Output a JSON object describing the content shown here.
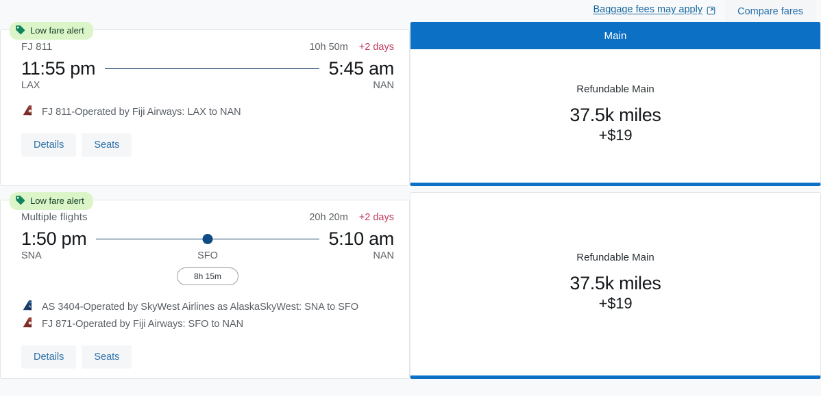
{
  "topbar": {
    "baggage_link": "Baggage fees may apply",
    "baggage_icon": "external-link-icon",
    "compare_button": "Compare fares"
  },
  "fare_column": {
    "header": "Main"
  },
  "results": [
    {
      "badge": "Low fare alert",
      "badge_icon": "price-tag-icon",
      "flight_number": "FJ 811",
      "duration": "10h 50m",
      "days_plus": "+2 days",
      "depart_time": "11:55 pm",
      "arrive_time": "5:45 am",
      "depart_code": "LAX",
      "arrive_code": "NAN",
      "stop_code": "",
      "layover": "",
      "has_stop": false,
      "operators": [
        {
          "icon": "fiji-airways-tail-icon",
          "text": "FJ 811-Operated by Fiji Airways: LAX to NAN"
        }
      ],
      "actions": [
        "Details",
        "Seats"
      ],
      "fare": {
        "show_header": true,
        "header": "Main",
        "name": "Refundable Main",
        "miles": "37.5k miles",
        "cash": "+$19"
      }
    },
    {
      "badge": "Low fare alert",
      "badge_icon": "price-tag-icon",
      "flight_number": "Multiple flights",
      "duration": "20h 20m",
      "days_plus": "+2 days",
      "depart_time": "1:50 pm",
      "arrive_time": "5:10 am",
      "depart_code": "SNA",
      "arrive_code": "NAN",
      "stop_code": "SFO",
      "layover": "8h 15m",
      "has_stop": true,
      "operators": [
        {
          "icon": "alaska-skywest-tail-icon",
          "text": "AS 3404-Operated by SkyWest Airlines as AlaskaSkyWest: SNA to SFO"
        },
        {
          "icon": "fiji-airways-tail-icon",
          "text": "FJ 871-Operated by Fiji Airways: SFO to NAN"
        }
      ],
      "actions": [
        "Details",
        "Seats"
      ],
      "fare": {
        "show_header": false,
        "header": "",
        "name": "Refundable Main",
        "miles": "37.5k miles",
        "cash": "+$19"
      }
    }
  ],
  "colors": {
    "brand_blue": "#0c70c4",
    "link_blue": "#2a6ea8",
    "alert_red": "#c0395b",
    "badge_green_bg": "#dcf5c8",
    "badge_green_fg": "#14402a",
    "line_navy": "#123a63"
  }
}
